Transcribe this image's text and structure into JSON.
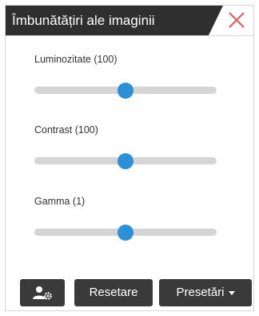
{
  "panel": {
    "title": "Îmbunătățiri ale imaginii",
    "close_icon": "close-icon"
  },
  "sliders": [
    {
      "label": "Luminozitate (100)",
      "value_fraction": 0.5
    },
    {
      "label": "Contrast (100)",
      "value_fraction": 0.5
    },
    {
      "label": "Gamma (1)",
      "value_fraction": 0.5
    }
  ],
  "footer": {
    "settings_icon": "user-settings-icon",
    "reset_label": "Resetare",
    "presets_label": "Presetări"
  },
  "colors": {
    "header_bg": "#2f2f2f",
    "close_x": "#e4595b",
    "slider_thumb": "#2c90d9",
    "slider_track": "#d5d5d5",
    "button_bg": "#3a3a3a"
  }
}
